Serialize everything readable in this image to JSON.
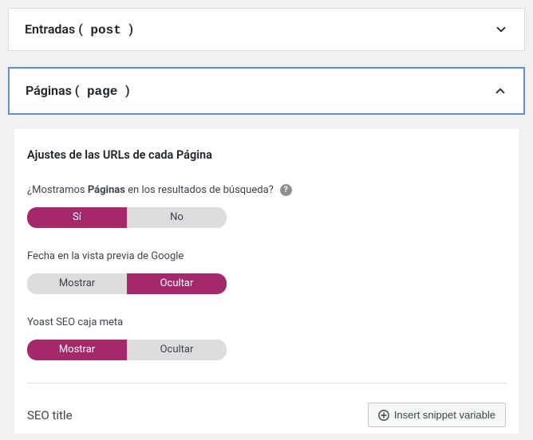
{
  "panels": {
    "posts": {
      "label": "Entradas",
      "slug": "post"
    },
    "pages": {
      "label": "Páginas",
      "slug": "page"
    }
  },
  "settings": {
    "section_title": "Ajustes de las URLs de cada Página",
    "show_in_search": {
      "label_before": "¿Mostramos ",
      "label_bold": "Páginas",
      "label_after": " en los resultados de búsqueda?",
      "yes": "Sí",
      "no": "No"
    },
    "date_preview": {
      "label": "Fecha en la vista previa de Google",
      "show": "Mostrar",
      "hide": "Ocultar"
    },
    "meta_box": {
      "label": "Yoast SEO caja meta",
      "show": "Mostrar",
      "hide": "Ocultar"
    },
    "seo_title": {
      "label": "SEO title",
      "insert_button": "Insert snippet variable"
    }
  }
}
